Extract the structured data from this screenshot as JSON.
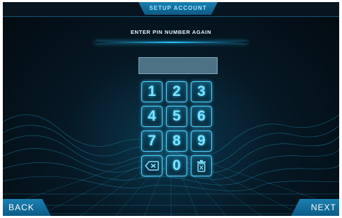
{
  "header": {
    "title": "SETUP ACCOUNT"
  },
  "instruction": "ENTER PIN NUMBER AGAIN",
  "pin_field": {
    "value": ""
  },
  "keypad": {
    "keys": [
      "1",
      "2",
      "3",
      "4",
      "5",
      "6",
      "7",
      "8",
      "9",
      "",
      "0",
      ""
    ],
    "icons": {
      "backspace": "backspace-icon",
      "clear": "trash-icon"
    }
  },
  "footer": {
    "back_label": "BACK",
    "next_label": "NEXT"
  },
  "colors": {
    "accent": "#29c4ff",
    "button": "#136e9c",
    "background": "#061824"
  }
}
